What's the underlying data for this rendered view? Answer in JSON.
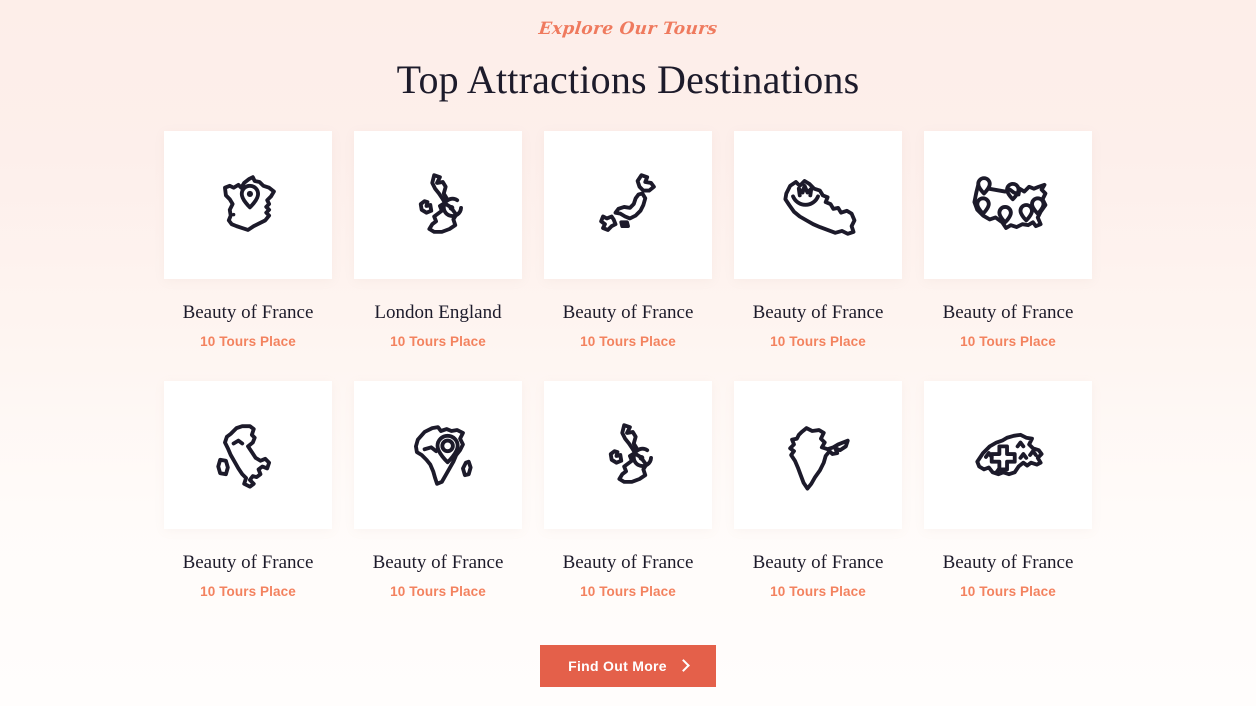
{
  "header": {
    "eyebrow": "Explore Our Tours",
    "title": "Top Attractions Destinations"
  },
  "cta": {
    "label": "Find Out More",
    "icon": "chevron-right-icon",
    "bg_color": "#e4604a",
    "text_color": "#ffffff"
  },
  "colors": {
    "accent": "#f3825f",
    "eyebrow": "#ef7a5e",
    "heading": "#1d1b2b",
    "card_bg": "#ffffff",
    "page_bg_top": "#fdeee9",
    "page_bg_bottom": "#fffdfc"
  },
  "cards": [
    {
      "title": "Beauty of France",
      "subtitle": "10 Tours Place",
      "icon": "france-map-icon"
    },
    {
      "title": "London England",
      "subtitle": "10 Tours Place",
      "icon": "uk-map-icon"
    },
    {
      "title": "Beauty of France",
      "subtitle": "10 Tours Place",
      "icon": "japan-map-icon"
    },
    {
      "title": "Beauty of France",
      "subtitle": "10 Tours Place",
      "icon": "nepal-map-icon"
    },
    {
      "title": "Beauty of France",
      "subtitle": "10 Tours Place",
      "icon": "usa-map-icon"
    },
    {
      "title": "Beauty of France",
      "subtitle": "10 Tours Place",
      "icon": "italy-map-icon"
    },
    {
      "title": "Beauty of France",
      "subtitle": "10 Tours Place",
      "icon": "africa-map-icon"
    },
    {
      "title": "Beauty of France",
      "subtitle": "10 Tours Place",
      "icon": "uk-map-icon"
    },
    {
      "title": "Beauty of France",
      "subtitle": "10 Tours Place",
      "icon": "india-map-icon"
    },
    {
      "title": "Beauty of France",
      "subtitle": "10 Tours Place",
      "icon": "switzerland-map-icon"
    }
  ]
}
